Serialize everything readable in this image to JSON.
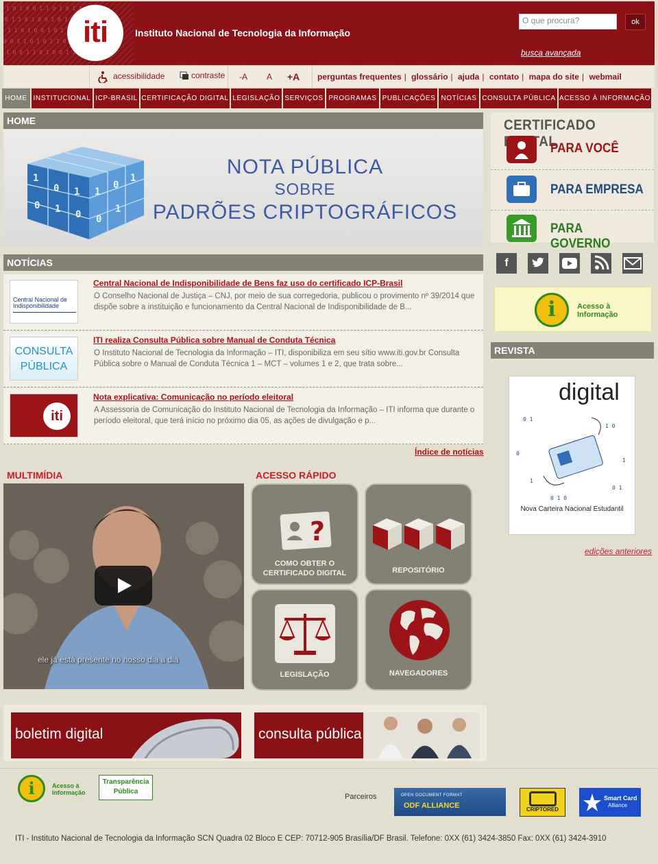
{
  "header": {
    "logo_text": "iti",
    "site_title": "Instituto Nacional de Tecnologia da Informação",
    "search_placeholder": "O que procura?",
    "search_button": "ok",
    "advanced_search": "busca avançada"
  },
  "utility": {
    "accessibility": "acessibilidade",
    "contrast": "contraste",
    "font_smaller": "-A",
    "font_normal": "A",
    "font_larger": "+A",
    "links": [
      "perguntas frequentes",
      "glossário",
      "ajuda",
      "contato",
      "mapa do site",
      "webmail"
    ]
  },
  "nav": {
    "items": [
      "HOME",
      "INSTITUCIONAL",
      "ICP-BRASIL",
      "CERTIFICAÇÃO DIGITAL",
      "LEGISLAÇÃO",
      "SERVIÇOS",
      "PROGRAMAS",
      "PUBLICAÇÕES",
      "NOTÍCIAS",
      "CONSULTA PÚBLICA",
      "ACESSO À INFORMAÇÃO"
    ],
    "active": "HOME"
  },
  "home": {
    "heading": "HOME",
    "banner_line1": "NOTA PÚBLICA",
    "banner_line2": "SOBRE",
    "banner_line3": "PADRÕES CRIPTOGRÁFICOS"
  },
  "news": {
    "heading": "NOTÍCIAS",
    "items": [
      {
        "title": "Central Nacional de Indisponibilidade de Bens faz uso do certificado ICP-Brasil",
        "text": "O Conselho Nacional de Justiça – CNJ, por meio de sua corregedoria, publicou o provimento nº 39/2014 que dispõe sobre a instituição e funcionamento da Central Nacional de Indisponibilidade de B...",
        "thumb_text": "Central Nacional de Indisponibilidade"
      },
      {
        "title": "ITI realiza Consulta Pública sobre Manual de Conduta Técnica",
        "text": "O Instituto Nacional de Tecnologia da Informação – ITI, disponibiliza em seu sítio www.iti.gov.br Consulta Pública sobre o Manual de Conduta Técnica 1 – MCT – volumes 1 e 2, que trata sobre...",
        "thumb_line1": "CONSULTA",
        "thumb_line2": "PÚBLICA"
      },
      {
        "title": "Nota explicativa: Comunicação no período eleitoral",
        "text": "A Assessoria de Comunicação do Instituto Nacional de Tecnologia da Informação – ITI informa que durante o período eleitoral, que terá início no próximo dia 05, as ações de divulgação e p...",
        "thumb_text": "iti"
      }
    ],
    "index_link": "Índice de notícias"
  },
  "multimedia": {
    "heading": "MULTIMÍDIA",
    "caption": "ele já está presente no nosso dia a dia"
  },
  "quick_access": {
    "heading": "ACESSO RÁPIDO",
    "tiles": [
      {
        "label_line1": "COMO OBTER O",
        "label_line2": "CERTIFICADO DIGITAL",
        "icon": "question-card-icon"
      },
      {
        "label_line1": "REPOSITÓRIO",
        "label_line2": "",
        "icon": "cubes-icon"
      },
      {
        "label_line1": "LEGISLAÇÃO",
        "label_line2": "",
        "icon": "scales-icon"
      },
      {
        "label_line1": "NAVEGADORES",
        "label_line2": "",
        "icon": "globe-icon"
      }
    ]
  },
  "bottom_banners": {
    "boletim": "boletim digital",
    "consulta": "consulta pública"
  },
  "sidebar": {
    "cert_title": "CERTIFICADO DIGITAL",
    "cert_items": [
      {
        "label": "PARA VOCÊ",
        "color": "#9c1418"
      },
      {
        "label": "PARA EMPRESA",
        "color": "#1f4c85"
      },
      {
        "label": "PARA GOVERNO",
        "color": "#2c7a1e"
      }
    ],
    "social": [
      "facebook-icon",
      "twitter-icon",
      "youtube-icon",
      "rss-icon",
      "email-icon"
    ],
    "acesso_line1": "Acesso à",
    "acesso_line2": "Informação",
    "revista_heading": "REVISTA",
    "revista_cover_title": "digital",
    "revista_cover_caption": "Nova Carteira Nacional Estudantil",
    "revista_more": "edições anteriores"
  },
  "footer": {
    "acesso_line1": "Acesso à",
    "acesso_line2": "Informação",
    "transparencia_line1": "Transparência",
    "transparencia_line2": "Pública",
    "parceiros": "Parceiros",
    "odf_line1": "OPEN DOCUMENT FORMAT",
    "odf_line2": "ODF ALLIANCE",
    "cripto": "CRIPTORED",
    "smartcard_line1": "Smart Card",
    "smartcard_line2": "Alliance",
    "address": "ITI - Instituto Nacional de Tecnologia da Informação SCN Quadra 02 Bloco E CEP: 70712-905 Brasília/DF Brasil. Telefone: 0XX (61) 3424-3850 Fax: 0XX (61) 3424-3910"
  },
  "colors": {
    "brand_red": "#8c1116",
    "link_red": "#b01016",
    "gray_header": "#838174",
    "page_bg": "#e3dfcf"
  }
}
